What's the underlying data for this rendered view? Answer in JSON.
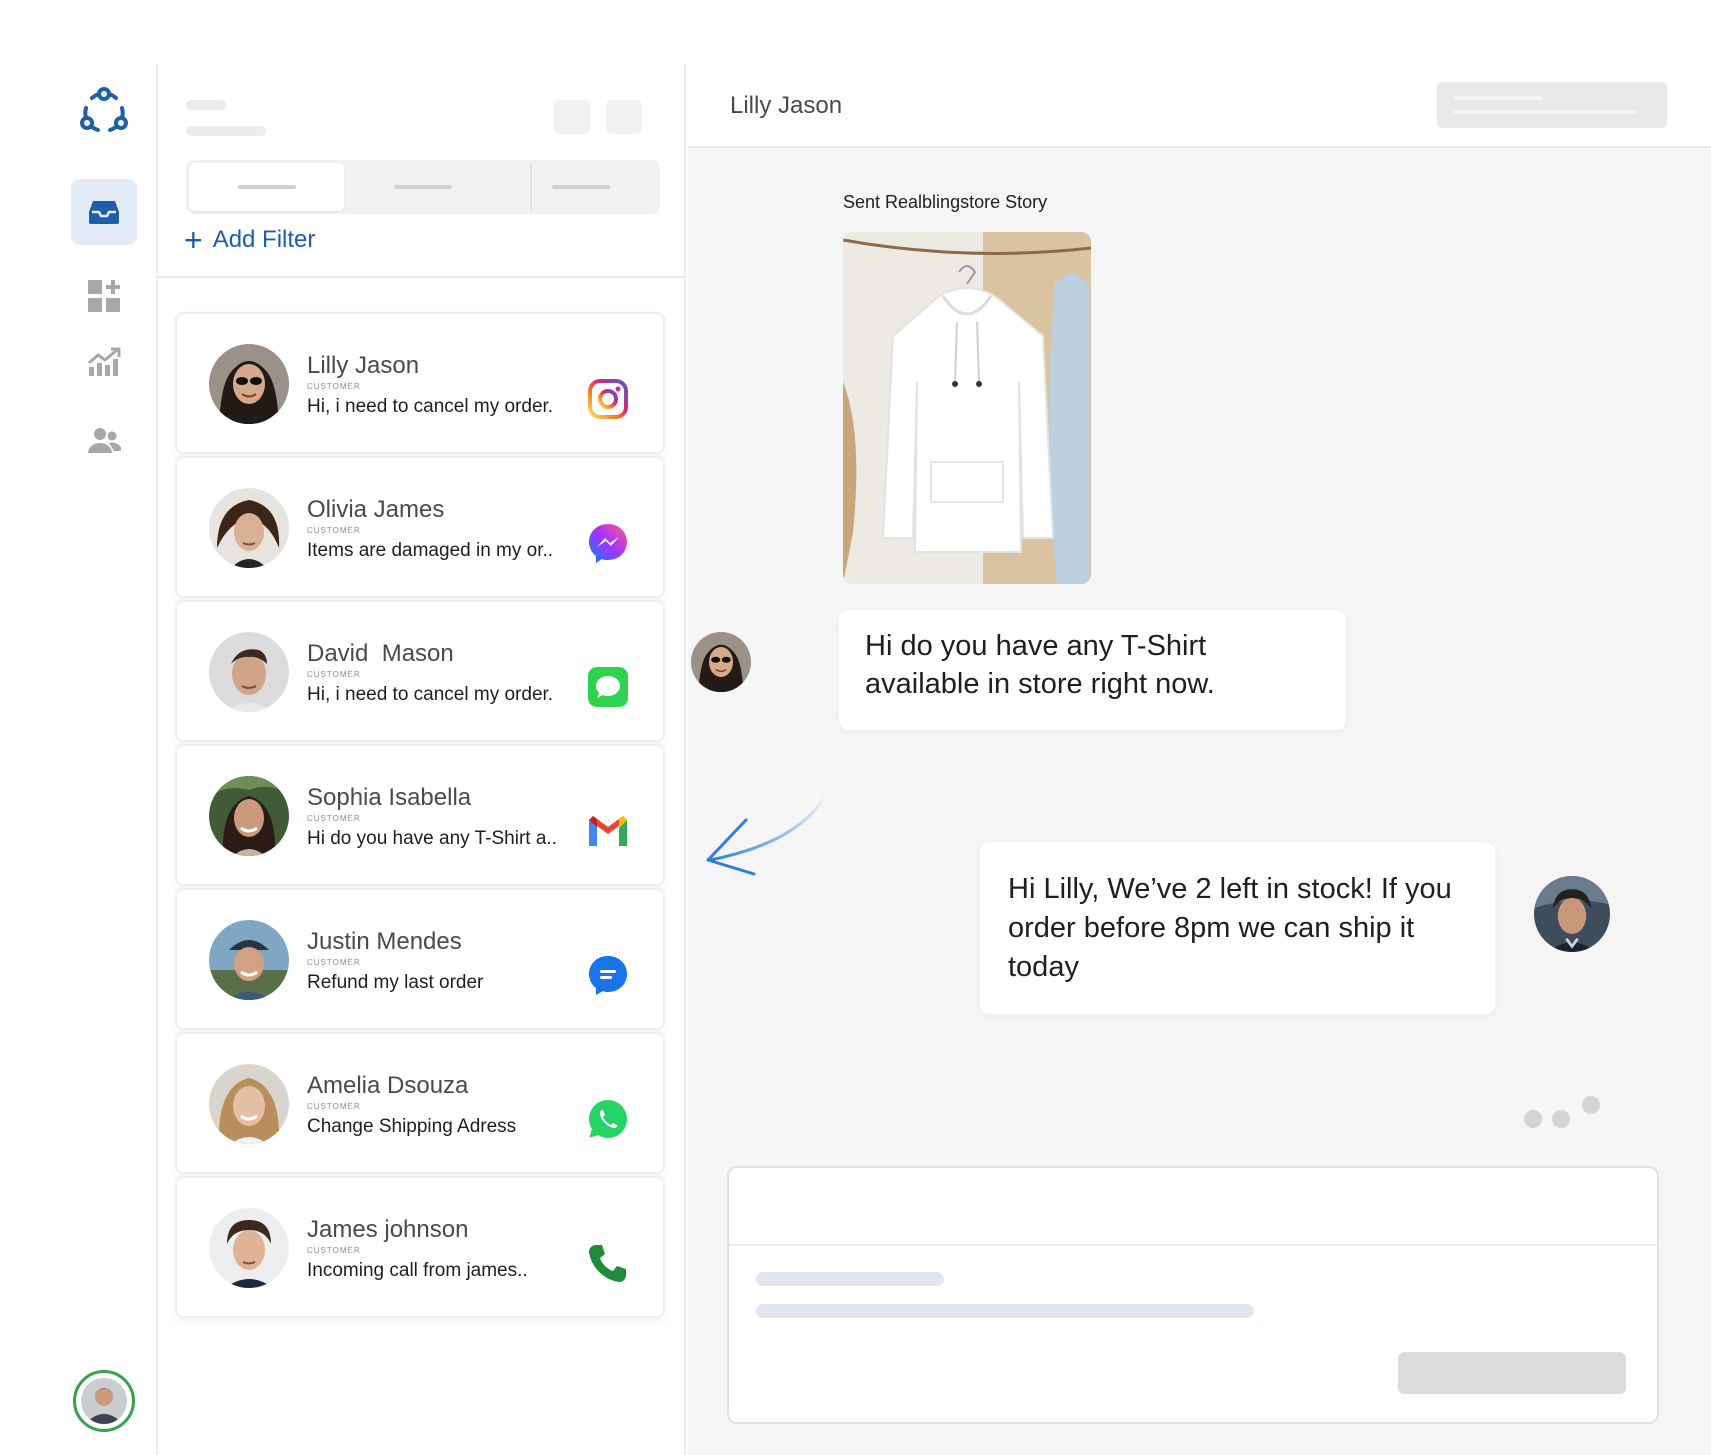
{
  "app": {
    "logo_icon": "team-ring-icon",
    "brand_color": "#1d5ea8"
  },
  "sidebar": {
    "items": [
      {
        "name": "inbox",
        "icon": "inbox-tray-icon",
        "active": true
      },
      {
        "name": "apps",
        "icon": "dashboard-add-icon",
        "active": false
      },
      {
        "name": "analytics",
        "icon": "chart-growth-icon",
        "active": false
      },
      {
        "name": "contacts",
        "icon": "users-icon",
        "active": false
      }
    ],
    "profile_icon": "user-avatar"
  },
  "list": {
    "add_filter_label": "Add Filter",
    "conversations": [
      {
        "name": "Lilly Jason",
        "role": "CUSTOMER",
        "message": "Hi, i need to cancel my order.",
        "channel": "instagram-icon"
      },
      {
        "name": "Olivia James",
        "role": "CUSTOMER",
        "message": "Items are damaged in my or..",
        "channel": "messenger-icon"
      },
      {
        "name": "David  Mason",
        "role": "CUSTOMER",
        "message": "Hi, i need to cancel my order.",
        "channel": "imessage-icon"
      },
      {
        "name": "Sophia Isabella",
        "role": "CUSTOMER",
        "message": "Hi do you have any T-Shirt a..",
        "channel": "gmail-icon"
      },
      {
        "name": "Justin Mendes",
        "role": "CUSTOMER",
        "message": "Refund my last order",
        "channel": "chat-bubble-icon"
      },
      {
        "name": "Amelia Dsouza",
        "role": "CUSTOMER",
        "message": "Change Shipping Adress",
        "channel": "whatsapp-icon"
      },
      {
        "name": "James johnson",
        "role": "CUSTOMER",
        "message": "Incoming call from james..",
        "channel": "phone-icon"
      }
    ]
  },
  "chat": {
    "contact_name": "Lilly Jason",
    "story_label": "Sent Realblingstore Story",
    "incoming_message": "Hi do you have any T-Shirt available in store right now.",
    "outgoing_message": "Hi Lilly, We’ve 2 left in stock! If you order before 8pm we can ship it today"
  }
}
